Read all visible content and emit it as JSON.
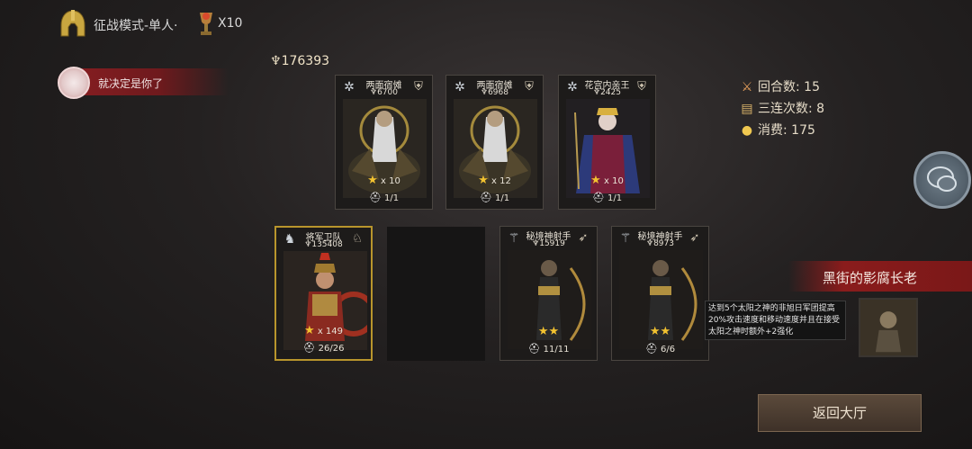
{
  "header": {
    "mode_label": "征战模式-单人·",
    "trophy_count": "X10",
    "mode_icon": "spartan-helmet-icon",
    "trophy_icon": "trophy-icon"
  },
  "player": {
    "name": "就决定是你了",
    "avatar_icon": "avatar-icon"
  },
  "total_power": "176393",
  "stats": {
    "rounds": "回合数: 15",
    "streak": "三连次数: 8",
    "cost": "消费: 175"
  },
  "cards": [
    {
      "name": "两面宿傩",
      "power": "6700",
      "stars": "x 10",
      "count": "1/1",
      "class_icon": "swirl-icon",
      "type_icon": "helmet-icon",
      "theme": "warlord"
    },
    {
      "name": "两面宿傩",
      "power": "6968",
      "stars": "x 12",
      "count": "1/1",
      "class_icon": "swirl-icon",
      "type_icon": "helmet-icon",
      "theme": "warlord"
    },
    {
      "name": "花宫内亲王",
      "power": "2425",
      "stars": "x 10",
      "count": "1/1",
      "class_icon": "swirl-icon",
      "type_icon": "helmet-icon",
      "theme": "princess"
    },
    {
      "name": "将军卫队",
      "power": "135408",
      "stars": "x 149",
      "count": "26/26",
      "class_icon": "wolf-icon",
      "type_icon": "horse-icon",
      "theme": "guard"
    },
    {
      "name": "秘境神射手",
      "power": "15919",
      "stars": "",
      "count": "11/11",
      "class_icon": "antler-icon",
      "type_icon": "bow-icon",
      "theme": "archer"
    },
    {
      "name": "秘境神射手",
      "power": "8973",
      "stars": "",
      "count": "6/6",
      "class_icon": "antler-icon",
      "type_icon": "bow-icon",
      "theme": "archer"
    }
  ],
  "boss": {
    "name": "黑街的影腐长老",
    "description": "达到5个太阳之神的非旭日军团提高20%攻击速度和移动速度并且在接受太阳之神时额外+2强化"
  },
  "return_button": "返回大厅",
  "colors": {
    "gold": "#b8952c",
    "banner_red": "#8a1c1c",
    "star": "#f2c230"
  }
}
